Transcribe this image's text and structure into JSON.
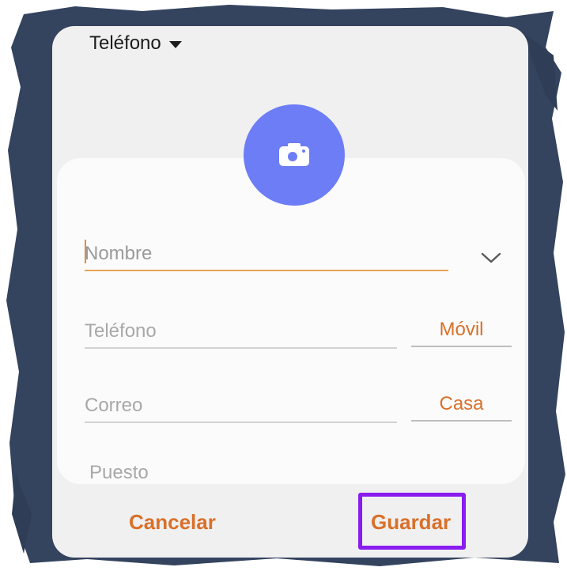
{
  "header": {
    "account_label": "Teléfono",
    "caret_icon": "caret-down-icon"
  },
  "avatar": {
    "icon": "camera-icon",
    "color": "#6c7df6"
  },
  "form": {
    "name_placeholder": "Nombre",
    "expand_icon": "chevron-down-icon",
    "phone_placeholder": "Teléfono",
    "phone_type": "Móvil",
    "email_placeholder": "Correo",
    "email_type": "Casa",
    "title_label": "Puesto"
  },
  "actions": {
    "cancel_label": "Cancelar",
    "save_label": "Guardar"
  },
  "colors": {
    "accent": "#d9702a",
    "highlight": "#8a1cf0",
    "frame": "#34435e"
  }
}
